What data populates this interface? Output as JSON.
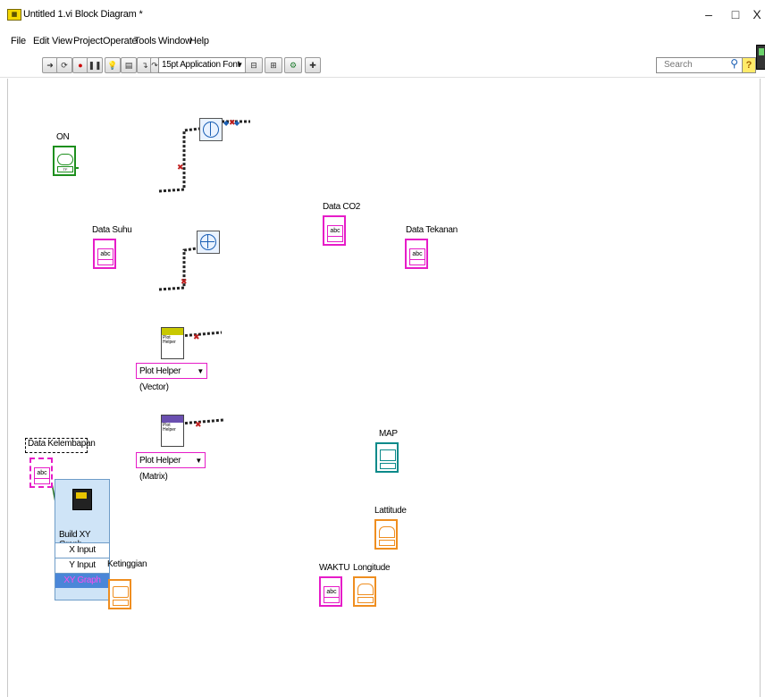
{
  "window": {
    "title": "Untitled 1.vi Block Diagram *",
    "app_icon": "labview-vi-icon",
    "controls": [
      "–",
      "□",
      "X"
    ]
  },
  "menu": [
    "File",
    "Edit",
    "View",
    "Project",
    "Operate",
    "Tools",
    "Window",
    "Help"
  ],
  "toolbar": {
    "font_select": "15pt Application Font",
    "search_placeholder": "Search",
    "help": "?"
  },
  "diagram": {
    "labels": {
      "on": "ON",
      "data_suhu": "Data Suhu",
      "data_co2": "Data CO2",
      "data_tekanan": "Data Tekanan",
      "data_kelembapan": "Data Kelembapan",
      "map": "MAP",
      "lattitude": "Lattitude",
      "waktu": "WAKTU",
      "longitude": "Longitude",
      "ketinggian": "Ketinggian"
    },
    "terminal_text": "abc",
    "tf_text": "TF",
    "plot_helper": {
      "text": "Plot Helper",
      "vector_label": "Plot Helper (Vector)",
      "matrix_label": "Plot Helper (Matrix)"
    },
    "build_xy": {
      "title": "Build XY Graph",
      "rows": [
        "X Input",
        "Y Input",
        "XY Graph"
      ]
    }
  },
  "colors": {
    "string": "#e61cc8",
    "boolean": "#1d8f1d",
    "numeric": "#ef8e20",
    "cluster": "#0b8a8a",
    "build_xy_bg": "#cfe4f7"
  }
}
